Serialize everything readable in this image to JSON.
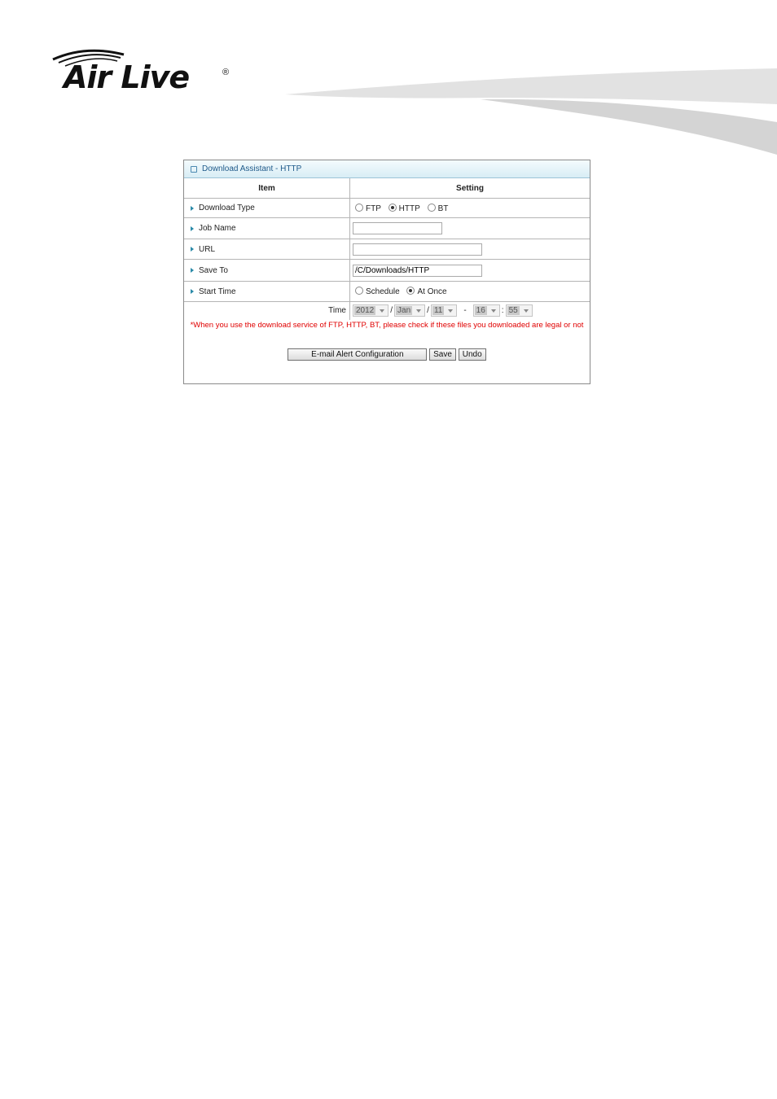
{
  "brand": {
    "name": "Air Live",
    "reg": "®"
  },
  "panel": {
    "title": "Download Assistant - HTTP",
    "col_item": "Item",
    "col_setting": "Setting",
    "rows": {
      "download_type": {
        "label": "Download Type",
        "options": [
          "FTP",
          "HTTP",
          "BT"
        ],
        "selected": "HTTP"
      },
      "job_name": {
        "label": "Job Name",
        "value": ""
      },
      "url": {
        "label": "URL",
        "value": ""
      },
      "save_to": {
        "label": "Save To",
        "value": "/C/Downloads/HTTP"
      },
      "start_time": {
        "label": "Start Time",
        "options": [
          "Schedule",
          "At Once"
        ],
        "selected": "At Once"
      },
      "time": {
        "label": "Time",
        "year": "2012",
        "month": "Jan",
        "day": "11",
        "hour": "16",
        "minute": "55",
        "sep_date": "/",
        "sep_dash": "-",
        "sep_colon": ":"
      }
    },
    "warning": "*When you use the download service of FTP, HTTP, BT, please check if these files you downloaded are legal or not",
    "buttons": {
      "email_alert": "E-mail Alert Configuration",
      "save": "Save",
      "undo": "Undo"
    }
  }
}
